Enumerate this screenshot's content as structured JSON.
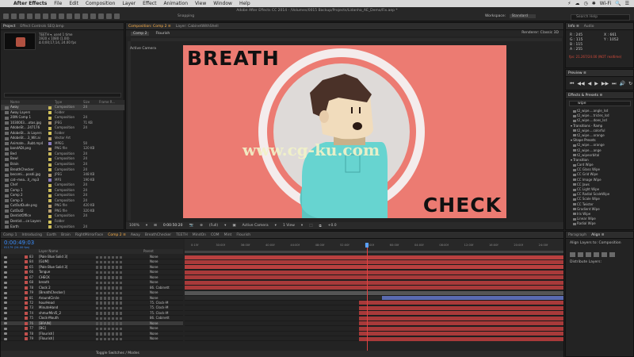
{
  "menu": {
    "apple": "",
    "app": "After Effects",
    "items": [
      "File",
      "Edit",
      "Composition",
      "Layer",
      "Effect",
      "Animation",
      "View",
      "Window",
      "Help"
    ],
    "status_right": [
      "⚡",
      "☁",
      "◷",
      "✱",
      "Wi-Fi",
      "🔍",
      "☰"
    ]
  },
  "toolbar": {
    "doc_title": "Adobe After Effects CC 2014 - /Volumes/0015 Backup/Projects/Lidanha_AE_Demo/Fix.aep *",
    "snapping": "Snapping",
    "workspace_label": "Workspace:",
    "workspace_value": "Standard",
    "search_help": "Search Help"
  },
  "project": {
    "tabs": [
      "Project",
      "Effect Controls SEQ.bmp"
    ],
    "selected_item": "TEETH ▾, used 1 time",
    "meta_line1": "1920 x 1080 (1.00)",
    "meta_line2": "Δ 0;00;17;14, 24.00 fps",
    "columns": [
      "Name",
      "Type",
      "Size",
      "Frame R..."
    ],
    "items": [
      {
        "name": "Away",
        "type": "Composition",
        "size": "24",
        "color": "#c9b95b"
      },
      {
        "name": "Away Layers",
        "type": "Folder",
        "size": "",
        "color": "#d4c45c"
      },
      {
        "name": "20IN Comp 1",
        "type": "Composition",
        "size": "24",
        "color": "#c9b95b"
      },
      {
        "name": "1030003....otos.jpg",
        "type": "JPEG",
        "size": "71 KB",
        "color": "#b8a070"
      },
      {
        "name": "AdobeSt....247176",
        "type": "Composition",
        "size": "24",
        "color": "#c9b95b"
      },
      {
        "name": "AdobeSt....ls Layers",
        "type": "Folder",
        "size": "",
        "color": "#d4c45c"
      },
      {
        "name": "AdobeSt....3_Wit.ai",
        "type": "Vector Art",
        "size": "",
        "color": "#b8a070"
      },
      {
        "name": "Animate....Rubt.mp4",
        "type": "MPEG",
        "size": "50",
        "color": "#8a7cc0"
      },
      {
        "name": "bandADI.png",
        "type": "PNG file",
        "size": "120 KB",
        "color": "#b8a070"
      },
      {
        "name": "Bed",
        "type": "Composition",
        "size": "24",
        "color": "#c9b95b"
      },
      {
        "name": "Bowl",
        "type": "Composition",
        "size": "24",
        "color": "#c9b95b"
      },
      {
        "name": "Brain",
        "type": "Composition",
        "size": "24",
        "color": "#c9b95b"
      },
      {
        "name": "BreathChecker",
        "type": "Composition",
        "size": "24",
        "color": "#c9b95b"
      },
      {
        "name": "becomi....posdi.jpg",
        "type": "JPEG",
        "size": "348 KB",
        "color": "#b8a070"
      },
      {
        "name": "cat--mea...ll_.mp3",
        "type": "MP3",
        "size": "190 KB",
        "color": "#8a7cc0"
      },
      {
        "name": "Chef",
        "type": "Composition",
        "size": "24",
        "color": "#c9b95b"
      },
      {
        "name": "Comp 1",
        "type": "Composition",
        "size": "24",
        "color": "#c9b95b"
      },
      {
        "name": "Comp 2",
        "type": "Composition",
        "size": "24",
        "color": "#c9b95b"
      },
      {
        "name": "Comp 3",
        "type": "Composition",
        "size": "24",
        "color": "#c9b95b"
      },
      {
        "name": "CutOutDude.png",
        "type": "PNG file",
        "size": "420 KB",
        "color": "#b8a070"
      },
      {
        "name": "CutOut2",
        "type": "PNG file",
        "size": "320 KB",
        "color": "#b8a070"
      },
      {
        "name": "DentistOffice",
        "type": "Composition",
        "size": "24",
        "color": "#c9b95b"
      },
      {
        "name": "Dentist....ce Layers",
        "type": "Folder",
        "size": "",
        "color": "#d4c45c"
      },
      {
        "name": "Earth",
        "type": "Composition",
        "size": "24",
        "color": "#c9b95b"
      }
    ]
  },
  "composition": {
    "tabs": [
      "Composition: Comp 2 ≡",
      "Layer: CabinetWithShell"
    ],
    "subtabs": [
      "Comp 2",
      "Flourish"
    ],
    "renderer_label": "Renderer:",
    "renderer_value": "Classic 3D",
    "camera_label": "Active Camera",
    "artwork": {
      "text_top": "BREATH",
      "text_bottom": "CHECK",
      "watermark": "www.cg-ku.com"
    },
    "viewer_bar": [
      "100%",
      "▾",
      "⊞",
      "0:00:50:20",
      "📷",
      "⊕",
      "(Full)",
      "▾",
      "▣",
      "Active Camera",
      "▾",
      "1 View",
      "▾",
      "⬚",
      "⧉",
      "+0.0"
    ]
  },
  "info": {
    "tabs": [
      "Info ≡",
      "Audio"
    ],
    "rgba": "R : 245\nG : 115\nB : 115\nA : 255",
    "xy": "X : 661\nY : 1052",
    "warning": "fps: 21.267/24.00 (NOT realtime)"
  },
  "preview": {
    "title": "Preview ≡",
    "buttons": [
      "⏮",
      "◀◀",
      "◀",
      "▶",
      "▶▶",
      "⏭",
      "🔊",
      "↻",
      "⊙"
    ]
  },
  "effects": {
    "title": "Effects & Presets ≡",
    "search_value": "wipe",
    "items": [
      {
        "label": "t2_wipe....angle_lsd",
        "cat": false
      },
      {
        "label": "t2_wipe....tricles_lsd",
        "cat": false
      },
      {
        "label": "t2_wipe....does_lsd",
        "cat": false
      },
      {
        "label": "▾ Transitions - Ramp",
        "cat": true
      },
      {
        "label": "t2_wipe....colorful",
        "cat": false
      },
      {
        "label": "t2_wipe....orange",
        "cat": false
      },
      {
        "label": "▾ Shape Presets",
        "cat": true
      },
      {
        "label": "t2_wipe....orange",
        "cat": false
      },
      {
        "label": "t2_wipe....ange",
        "cat": false
      },
      {
        "label": "t2_wipeorbital",
        "cat": false
      },
      {
        "label": "▾ Transition",
        "cat": true
      },
      {
        "label": "Card Wipe",
        "cat": false
      },
      {
        "label": "CC Glass Wipe",
        "cat": false
      },
      {
        "label": "CC Grid Wipe",
        "cat": false
      },
      {
        "label": "CC Image Wipe",
        "cat": false
      },
      {
        "label": "CC Jaws",
        "cat": false
      },
      {
        "label": "CC Light Wipe",
        "cat": false
      },
      {
        "label": "CC Radial ScaleWipe",
        "cat": false
      },
      {
        "label": "CC Scale Wipe",
        "cat": false
      },
      {
        "label": "CC Twister",
        "cat": false
      },
      {
        "label": "Gradient Wipe",
        "cat": false
      },
      {
        "label": "Iris Wipe",
        "cat": false
      },
      {
        "label": "Linear Wipe",
        "cat": false
      },
      {
        "label": "Radial Wipe",
        "cat": false
      }
    ]
  },
  "timeline": {
    "tabs": [
      "Comp 1",
      "Introducing",
      "Earth",
      "Brain",
      "RightMirrorFace",
      "Comp 2 ≡",
      "Away",
      "BreathChecker",
      "TEETH",
      "MindOn",
      "COM",
      "Mint",
      "Flourish"
    ],
    "timecode": "0:00:49:03",
    "fps_line": "01179 (24.00 fps)",
    "col_labels": [
      "Layer Name",
      "Parent"
    ],
    "ruler_ticks": [
      "0:15f",
      "30:00f",
      "36:00f",
      "40:00f",
      "44:00f",
      "48:00f",
      "52:00f",
      "56:00f",
      "60:00f",
      "04:00f",
      "08:00f",
      "12:00f",
      "16:00f",
      "20:00f",
      "24:00f"
    ],
    "layers": [
      {
        "num": "83",
        "name": "[Pale Blue Solid 3]",
        "parent": "None",
        "color": "#c0504d",
        "bars": [
          [
            0,
            1,
            "#b9403f"
          ]
        ]
      },
      {
        "num": "84",
        "name": "[GUM]",
        "parent": "None",
        "color": "#c0504d",
        "bars": [
          [
            0,
            1,
            "#a83a3a"
          ]
        ]
      },
      {
        "num": "65",
        "name": "[Pale Blue Solid 3]",
        "parent": "None",
        "color": "#c0504d",
        "bars": [
          [
            0,
            1,
            "#b9403f"
          ]
        ]
      },
      {
        "num": "66",
        "name": "Tongue",
        "parent": "None",
        "color": "#c0504d",
        "bars": [
          [
            0,
            1,
            "#a83a3a"
          ]
        ]
      },
      {
        "num": "67",
        "name": "CHECK",
        "parent": "None",
        "color": "#c0504d",
        "bars": [
          [
            0,
            1,
            "#a83a3a"
          ]
        ]
      },
      {
        "num": "68",
        "name": "breath",
        "parent": "None",
        "color": "#c0504d",
        "bars": [
          [
            0,
            1,
            "#a83a3a"
          ]
        ]
      },
      {
        "num": "78",
        "name": "Clock 2",
        "parent": "86. Cabinett",
        "color": "#c0504d",
        "bars": [
          [
            0,
            1,
            "#a83a3a"
          ]
        ]
      },
      {
        "num": "79",
        "name": "[BreathChecker]",
        "parent": "None",
        "color": "#c0504d",
        "bars": [
          [
            0,
            1,
            "#555555"
          ]
        ]
      },
      {
        "num": "81",
        "name": "AroundCircle",
        "parent": "None",
        "color": "#c0504d",
        "bars": [
          [
            0,
            0.52,
            "#2a2a2a"
          ],
          [
            0.52,
            1,
            "#5a6ab0"
          ]
        ]
      },
      {
        "num": "72",
        "name": "hourHead",
        "parent": "75. Clock-M",
        "color": "#c0504d",
        "bars": [
          [
            0.46,
            1,
            "#a83a3a"
          ]
        ]
      },
      {
        "num": "73",
        "name": "MinuteHand",
        "parent": "75. Clock-M",
        "color": "#c0504d",
        "bars": [
          [
            0.46,
            1,
            "#a83a3a"
          ]
        ]
      },
      {
        "num": "74",
        "name": "shmurMinl5_2",
        "parent": "75. Clock-M",
        "color": "#c0504d",
        "bars": [
          [
            0.46,
            1,
            "#a83a3a"
          ]
        ]
      },
      {
        "num": "75",
        "name": "Clock-Mouth",
        "parent": "86. Cabinett",
        "color": "#c0504d",
        "bars": [
          [
            0.46,
            1,
            "#a83a3a"
          ]
        ]
      },
      {
        "num": "76",
        "name": "[BRAIN]",
        "parent": "None",
        "color": "#c0504d",
        "bars": [
          [
            0.46,
            1,
            "#a83a3a"
          ]
        ]
      },
      {
        "num": "77",
        "name": "[BG]",
        "parent": "None",
        "color": "#c0504d",
        "bars": [
          [
            0.46,
            1,
            "#a83a3a"
          ]
        ]
      },
      {
        "num": "78",
        "name": "[Flourish]",
        "parent": "None",
        "color": "#c0504d",
        "bars": [
          [
            0.46,
            1,
            "#a83a3a"
          ]
        ]
      },
      {
        "num": "79",
        "name": "[Flourish]",
        "parent": "None",
        "color": "#c0504d",
        "bars": [
          [
            0.46,
            1,
            "#a83a3a"
          ]
        ]
      }
    ],
    "footer": "Toggle Switches / Modes"
  },
  "align": {
    "tabs": [
      "Paragraph",
      "Align ≡"
    ],
    "align_to_label": "Align Layers to:",
    "align_to_value": "Composition",
    "distribute_label": "Distribute Layers:"
  }
}
